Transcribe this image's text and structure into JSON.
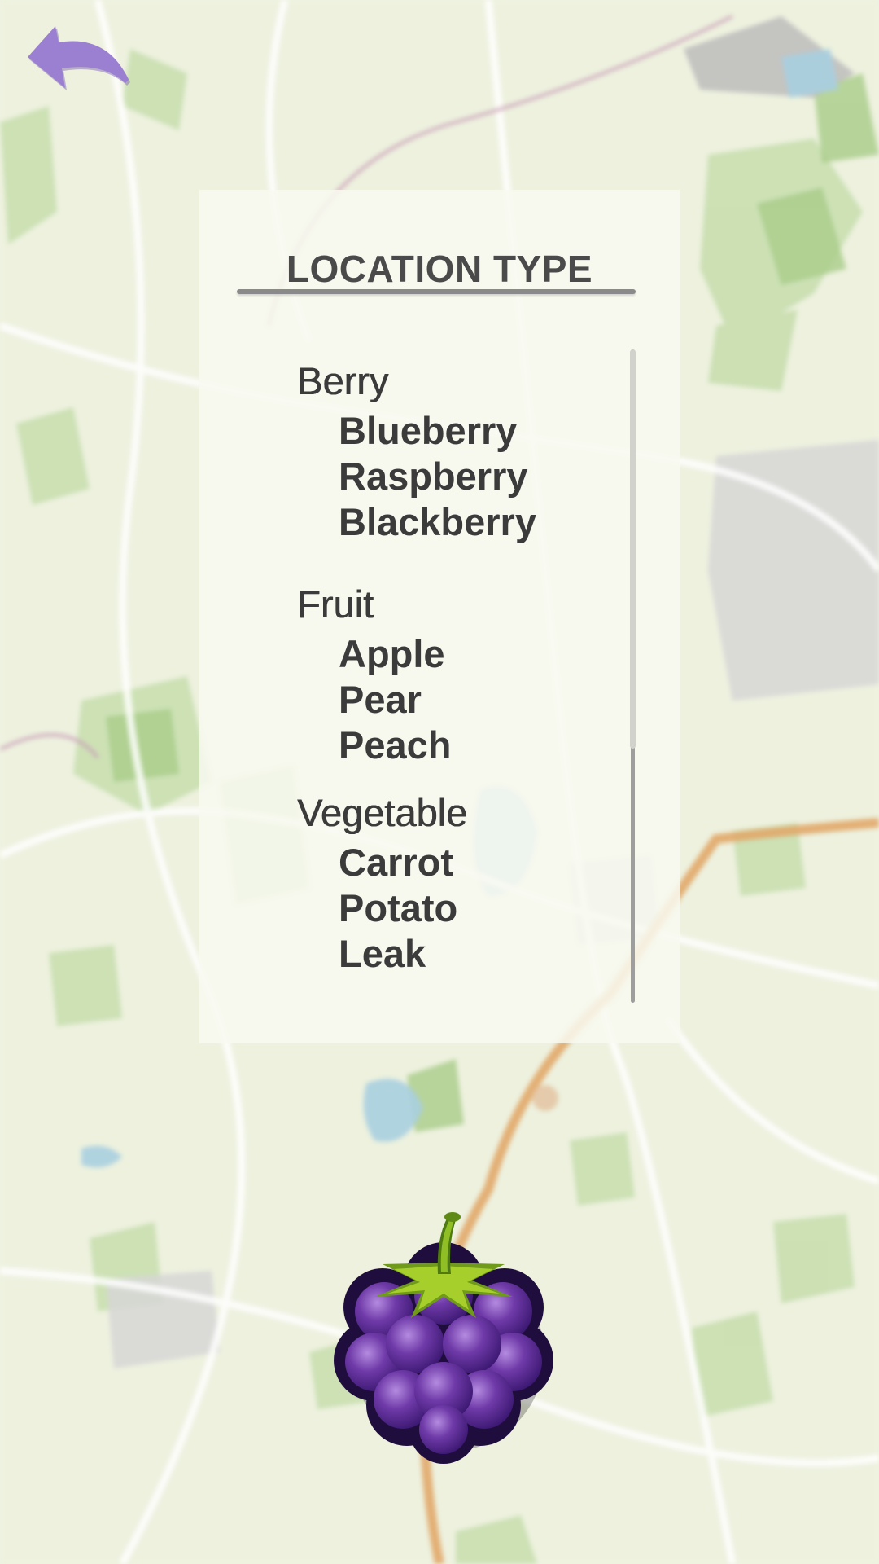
{
  "header": {
    "back_icon": "back-arrow-icon",
    "back_color": "#9b7fd0"
  },
  "panel": {
    "title": "LOCATION TYPE",
    "categories": [
      {
        "label": "Berry",
        "items": [
          "Blueberry",
          "Raspberry",
          "Blackberry"
        ]
      },
      {
        "label": "Fruit",
        "items": [
          "Apple",
          "Pear",
          "Peach"
        ]
      },
      {
        "label": "Vegetable",
        "items": [
          "Carrot",
          "Potato",
          "Leak"
        ]
      }
    ]
  },
  "selected_icon": {
    "name": "blackberry-icon",
    "color": "#5b2d8a"
  }
}
